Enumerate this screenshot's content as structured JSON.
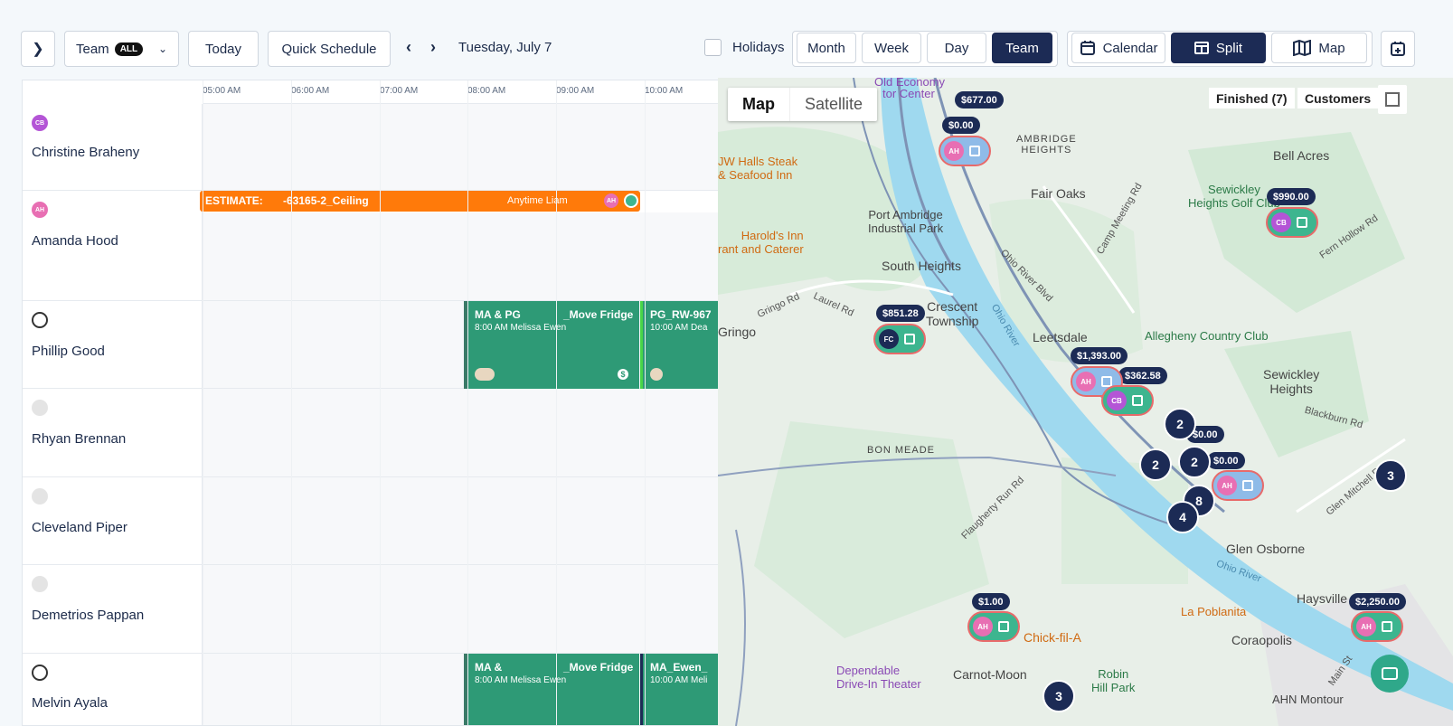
{
  "toolbar": {
    "team_label": "Team",
    "team_badge": "ALL",
    "today": "Today",
    "quick_schedule": "Quick Schedule",
    "date": "Tuesday, July 7",
    "holidays": "Holidays",
    "views": [
      "Month",
      "Week",
      "Day",
      "Team"
    ],
    "active_view": "Team",
    "layouts": [
      "Calendar",
      "Split",
      "Map"
    ],
    "active_layout": "Split"
  },
  "calendar": {
    "times": [
      "05:00 AM",
      "06:00 AM",
      "07:00 AM",
      "08:00 AM",
      "09:00 AM",
      "10:00 AM"
    ],
    "people": [
      {
        "name": "Christine Braheny",
        "initials": "CB",
        "color": "#b455d6"
      },
      {
        "name": "Amanda Hood",
        "initials": "AH",
        "color": "#e86fb3"
      },
      {
        "name": "Phillip Good",
        "initials": "",
        "color": "#333333"
      },
      {
        "name": "Rhyan Brennan",
        "initials": "",
        "color": "#dddddd"
      },
      {
        "name": "Cleveland Piper",
        "initials": "",
        "color": "#dddddd"
      },
      {
        "name": "Demetrios Pappan",
        "initials": "",
        "color": "#dddddd"
      },
      {
        "name": "Melvin Ayala",
        "initials": "",
        "color": "#333333"
      }
    ],
    "events": {
      "estimate": {
        "title": "ESTIMATE:",
        "code": "-63165-2_Ceiling",
        "note": "Anytime  Liam",
        "color": "#ff7a0a"
      },
      "phillip_1": {
        "title": "MA & PG",
        "title2": "_Move Fridge",
        "time": "8:00 AM Melissa Ewen",
        "color": "#2e9a76"
      },
      "phillip_2": {
        "title": "PG_RW-967",
        "time": "10:00 AM Dea",
        "color": "#2e9a76"
      },
      "melvin_1": {
        "title": "MA &",
        "title2": "_Move Fridge",
        "time": "8:00 AM Melissa Ewen",
        "color": "#2e9a76"
      },
      "melvin_2": {
        "title": "MA_Ewen_",
        "time": "10:00 AM Meli",
        "color": "#2e9a76"
      }
    }
  },
  "map": {
    "map_type": [
      "Map",
      "Satellite"
    ],
    "finished": "Finished (7)",
    "customers": "Customers",
    "prices": [
      "$677.00",
      "$0.00",
      "$990.00",
      "$851.28",
      "$1,393.00",
      "$362.58",
      "$0.00",
      "$0.00",
      "$1.00",
      "$2,250.00"
    ],
    "clusters": [
      "2",
      "2",
      "2",
      "8",
      "4",
      "3",
      "3"
    ],
    "places": {
      "old_economy": "Old Economy",
      "visitor_center": "tor Center",
      "ambridge_heights": "AMBRIDGE\nHEIGHTS",
      "bell_acres": "Bell Acres",
      "fair_oaks": "Fair Oaks",
      "sewickley_heights_golf": "Sewickley\nHeights Golf Club",
      "jw_halls": "JW Halls Steak\n& Seafood Inn",
      "port_ambridge": "Port Ambridge\nIndustrial Park",
      "harolds": "Harold's Inn\nrant and Caterer",
      "south_heights": "South Heights",
      "crescent": "Crescent\nTownship",
      "leetsdale": "Leetsdale",
      "allegheny_cc": "Allegheny Country Club",
      "sewickley_heights": "Sewickley\nHeights",
      "gringo": "Gringo",
      "bon_meade": "BON MEADE",
      "glen_osborne": "Glen Osborne",
      "haysville": "Haysville",
      "la_poblanita": "La Poblanita",
      "coraopolis": "Coraopolis",
      "chick_fil_a": "Chick-fil-A",
      "dependable": "Dependable\nDrive-In Theater",
      "carnot_moon": "Carnot-Moon",
      "robin_hill": "Robin\nHill Park",
      "ahn": "AHN Montour",
      "ohio_river": "Ohio River",
      "ohio_river_blvd": "Ohio River Blvd",
      "camp_meeting": "Camp Meeting Rd",
      "gringo_rd": "Gringo Rd",
      "laurel_rd": "Laurel Rd",
      "flaugherty": "Flaugherty Run Rd",
      "fern_hollow": "Fern Hollow Rd",
      "blackburn": "Blackburn Rd",
      "main_st": "Main St",
      "mitchell": "Glen Mitchell Rd"
    }
  }
}
